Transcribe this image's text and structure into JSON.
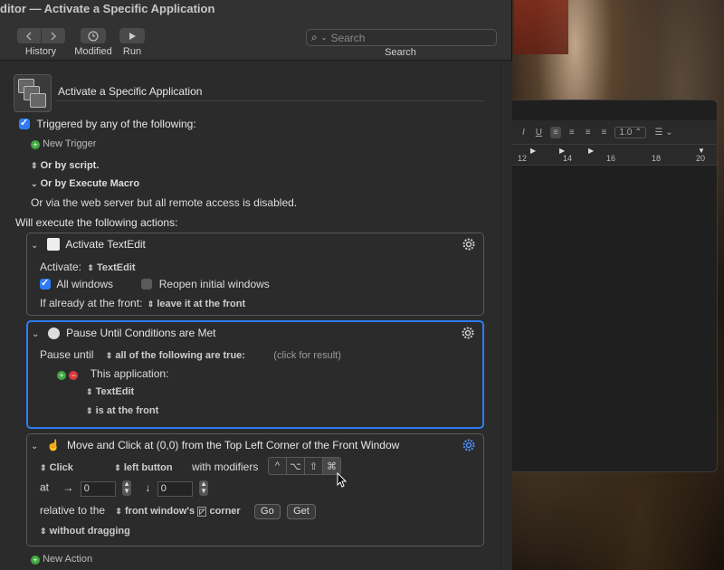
{
  "window": {
    "title": "ditor — Activate a Specific Application"
  },
  "toolbar": {
    "history_label": "History",
    "modified_label": "Modified",
    "run_label": "Run",
    "search_placeholder": "Search",
    "search_label": "Search"
  },
  "macro": {
    "name": "Activate a Specific Application",
    "triggered_label": "Triggered by any of the following:",
    "new_trigger": "New Trigger",
    "or_by_script": "Or by script.",
    "or_by_execute_macro": "Or by Execute Macro",
    "web_server_note": "Or via the web server but all remote access is disabled.",
    "will_execute": "Will execute the following actions:",
    "new_action": "New Action"
  },
  "actions": [
    {
      "title": "Activate TextEdit",
      "activate_label": "Activate:",
      "activate_value": "TextEdit",
      "all_windows": "All windows",
      "reopen": "Reopen initial windows",
      "if_front_label": "If already at the front:",
      "if_front_value": "leave it at the front"
    },
    {
      "title": "Pause Until Conditions are Met",
      "pause_until": "Pause until",
      "condition": "all of the following are true:",
      "click_result": "(click for result)",
      "this_app": "This application:",
      "app_value": "TextEdit",
      "app_state": "is at the front"
    },
    {
      "title": "Move and Click at (0,0) from the Top Left Corner of the Front Window",
      "click": "Click",
      "button": "left button",
      "with_modifiers": "with modifiers",
      "modifiers": [
        "^",
        "⌥",
        "⇧",
        "⌘"
      ],
      "at": "at",
      "x": "0",
      "y": "0",
      "relative_to": "relative to the",
      "relative_value": "front window's",
      "corner": "corner",
      "go": "Go",
      "get": "Get",
      "dragging": "without dragging"
    }
  ],
  "textedit": {
    "ruler": [
      "12",
      "14",
      "16",
      "18",
      "20"
    ],
    "line_spacing": "1.0"
  }
}
